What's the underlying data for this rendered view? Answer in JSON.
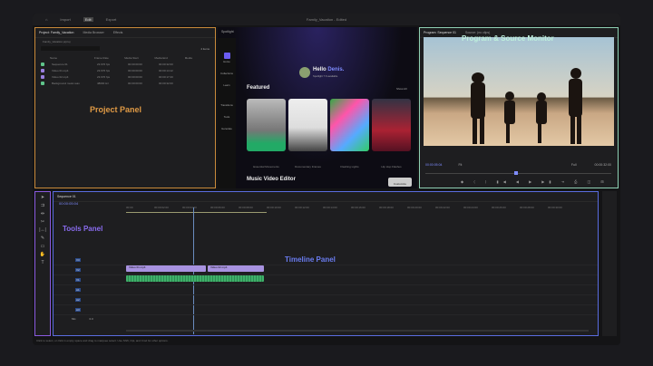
{
  "topbar": {
    "home": "home-icon",
    "import": "Import",
    "edit": "Edit",
    "export": "Export",
    "title": "Family_Vacation - Edited"
  },
  "project": {
    "tabs": [
      "Project: Family_Vacation",
      "Media Browser",
      "Effects"
    ],
    "path": "Family_Vacation.prproj",
    "items_count": "4 items",
    "columns": [
      "Name",
      "Frame Rate",
      "Media Start",
      "Media End",
      "Media"
    ],
    "rows": [
      {
        "name": "Sequence 01",
        "fps": "23.976 fps",
        "start": "00:00:00:00",
        "end": "00:00:32:00",
        "color": "#5fc48a"
      },
      {
        "name": "Video 01.mp4",
        "fps": "23.976 fps",
        "start": "00:00:00:00",
        "end": "00:00:14:12",
        "color": "#9a7fe0"
      },
      {
        "name": "Video 02.mp4",
        "fps": "23.976 fps",
        "start": "00:00:00:00",
        "end": "00:00:17:20",
        "color": "#9a7fe0"
      },
      {
        "name": "Background music.wav",
        "fps": "48000 Hz",
        "start": "00:00:00:00",
        "end": "00:00:32:00",
        "color": "#5fc48a"
      }
    ],
    "annotation": "Project Panel"
  },
  "spotlight": {
    "tab": "Spotlight",
    "greeting": "Hello",
    "user": "Denis.",
    "sub": "Spotlight 7.6 available",
    "nav": [
      "Home",
      "Collections",
      "Learn",
      "Transitions",
      "Tools",
      "Generate"
    ],
    "featured_title": "Featured",
    "show_all": "Show All",
    "featured": [
      "Essential Movements",
      "Documentary Frames",
      "Flashing Lights",
      "Hip Hop Flashes"
    ],
    "music_title": "Music Video Editor",
    "customize": "Customize"
  },
  "monitor": {
    "tabs": [
      "Program: Sequence 01",
      "Source: (no clips)"
    ],
    "annotation": "Program & Source Monitor",
    "timecode": "00:00:05:04",
    "fit": "Fit",
    "quality": "Full",
    "duration": "00:00:32:00"
  },
  "timeline": {
    "tab": "Sequence 01",
    "timecode": "00:00:05:04",
    "annotation": "Timeline Panel",
    "tools_annotation": "Tools Panel",
    "ticks": [
      "00:00",
      "00:00:02:00",
      "00:00:04:00",
      "00:00:06:00",
      "00:00:08:00",
      "00:00:10:00",
      "00:00:12:00",
      "00:00:14:00",
      "00:00:16:00",
      "00:00:18:00",
      "00:00:20:00",
      "00:00:22:00",
      "00:00:24:00",
      "00:00:26:00",
      "00:00:28:00",
      "00:00:30:00"
    ],
    "tracks": [
      "V3",
      "V2",
      "V1",
      "A1",
      "A2",
      "A3"
    ],
    "clips": [
      "Video 01.mp4",
      "Video 02.mp4"
    ],
    "mix": "Mix",
    "mix_value": "0.0"
  },
  "status": "Click to select, or click in empty space and drag to marquee select. Use Shift, Opt, and Cmd for other options.",
  "colors": {
    "project_border": "#c98a3a",
    "monitor_border": "#8fd1b5",
    "timeline_border": "#5a6de0",
    "tools_border": "#8a5ae0",
    "accent": "#7f8cff"
  }
}
